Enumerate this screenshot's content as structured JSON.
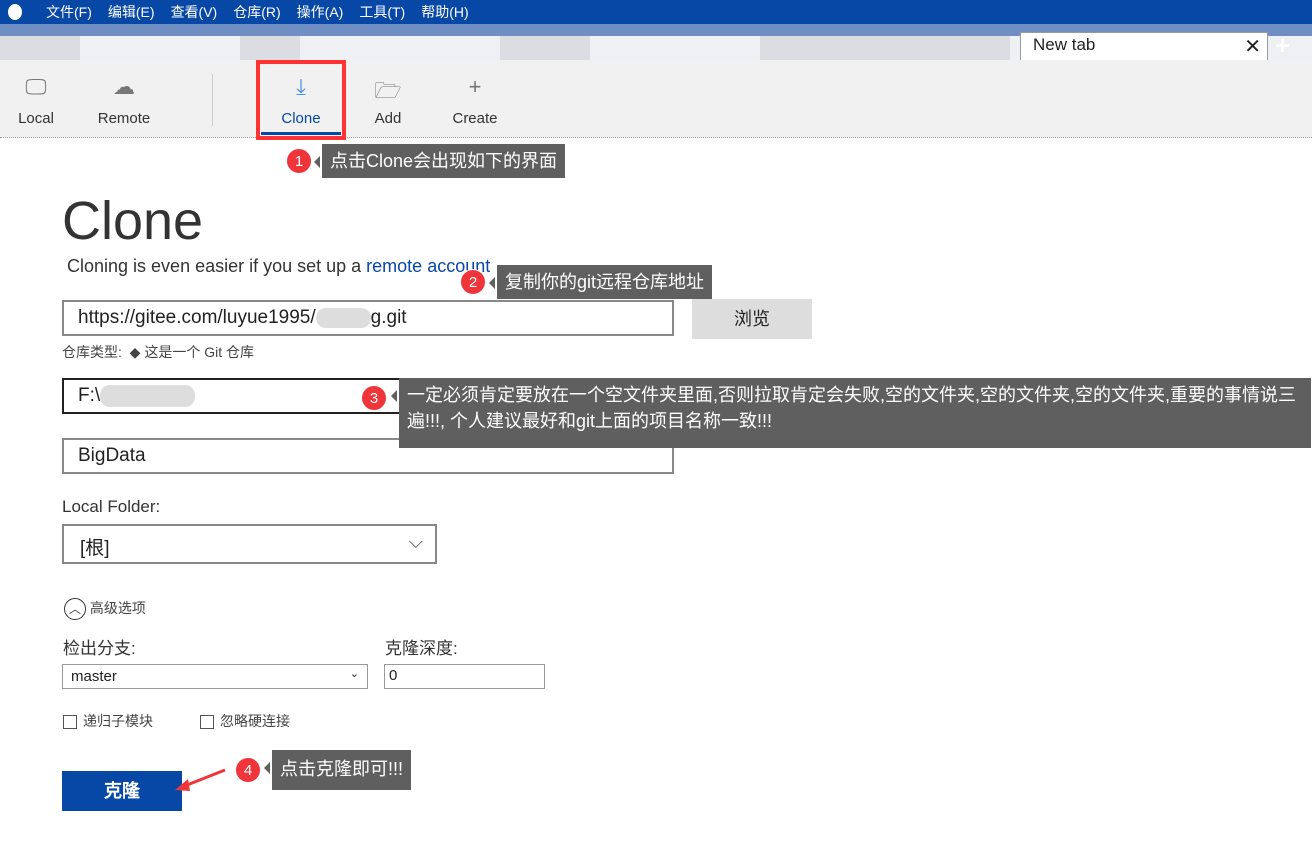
{
  "menu": [
    "文件(F)",
    "编辑(E)",
    "查看(V)",
    "仓库(R)",
    "操作(A)",
    "工具(T)",
    "帮助(H)"
  ],
  "tab": {
    "label": "New tab"
  },
  "toolbar": {
    "local": "Local",
    "remote": "Remote",
    "clone": "Clone",
    "add": "Add",
    "create": "Create"
  },
  "page": {
    "title": "Clone",
    "subtitle_prefix": "Cloning is even easier if you set up a ",
    "subtitle_link": "remote account"
  },
  "form": {
    "url": "https://gitee.com/luyue1995/",
    "url_suffix": "g.git",
    "browse": "浏览",
    "repo_type_label": "仓库类型:",
    "repo_type_value": "这是一个 Git 仓库",
    "dest": "F:\\",
    "name": "BigData",
    "local_folder_label": "Local Folder:",
    "local_folder_value": "[根]",
    "advanced": "高级选项",
    "branch_label": "检出分支:",
    "branch_value": "master",
    "depth_label": "克隆深度:",
    "depth_value": "0",
    "recurse": "递归子模块",
    "ignore_hardlinks": "忽略硬连接",
    "clone_button": "克隆"
  },
  "annotations": [
    {
      "n": "1",
      "text": "点击Clone会出现如下的界面"
    },
    {
      "n": "2",
      "text": "复制你的git远程仓库地址"
    },
    {
      "n": "3",
      "text": "一定必须肯定要放在一个空文件夹里面,否则拉取肯定会失败,空的文件夹,空的文件夹,空的文件夹,重要的事情说三遍!!!, 个人建议最好和git上面的项目名称一致!!!"
    },
    {
      "n": "4",
      "text": "点击克隆即可!!!"
    }
  ],
  "colors": {
    "brand": "#0747a6",
    "annotation": "#f0353a",
    "tooltip": "#5f5f5f"
  }
}
